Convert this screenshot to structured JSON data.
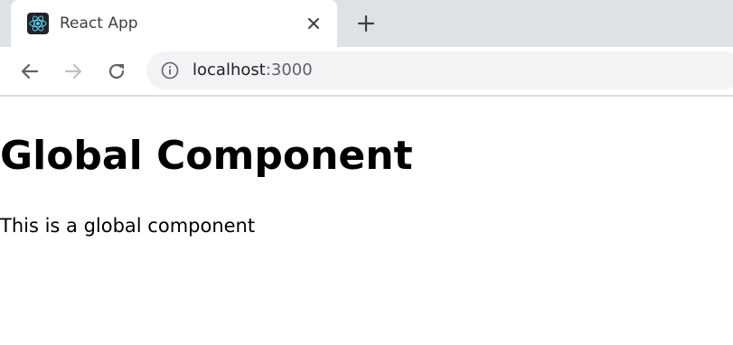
{
  "browser": {
    "tab": {
      "title": "React App",
      "favicon": "react-logo-icon",
      "close_icon": "close-icon"
    },
    "new_tab_icon": "plus-icon",
    "nav": {
      "back_icon": "arrow-left-icon",
      "forward_icon": "arrow-right-icon",
      "reload_icon": "reload-icon"
    },
    "address": {
      "info_icon": "info-icon",
      "host": "localhost",
      "port": ":3000"
    },
    "colors": {
      "tabstrip": "#dee1e6",
      "omnibox": "#f1f3f4",
      "react_logo": "#61dafb"
    }
  },
  "page": {
    "heading": "Global Component",
    "text": "This is a global component"
  }
}
